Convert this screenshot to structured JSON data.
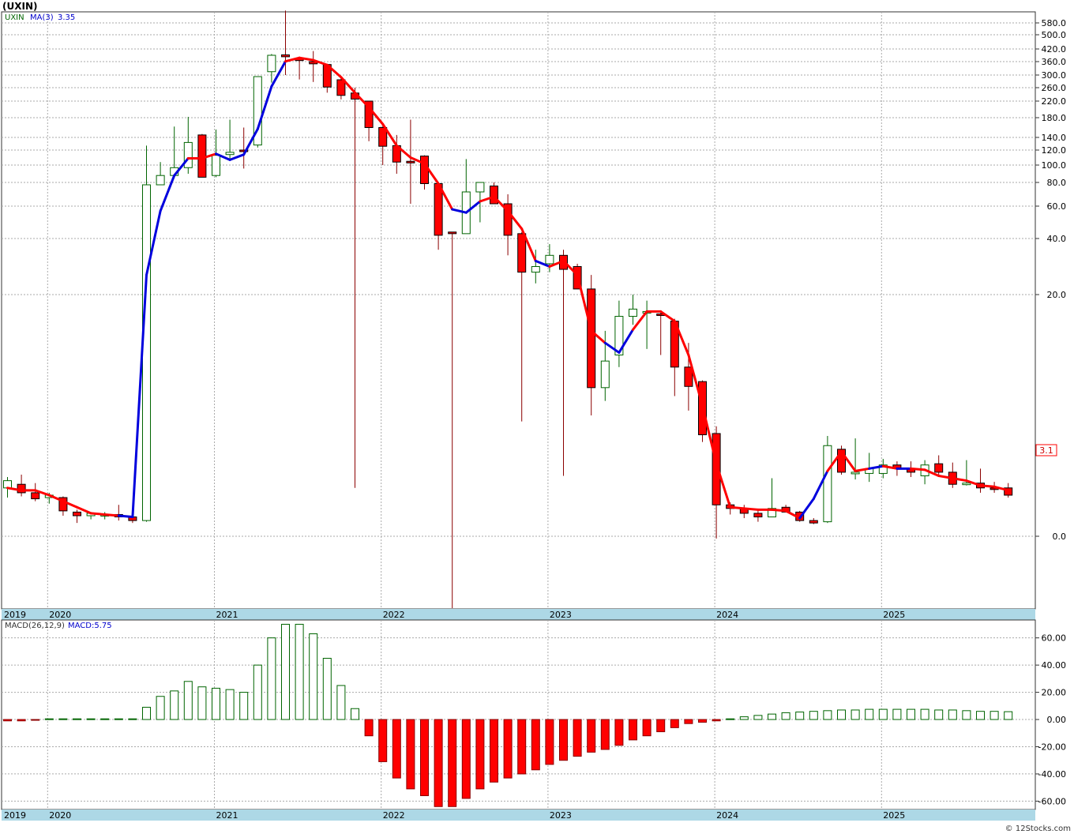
{
  "title": "(UXIN)",
  "watermark": "© 12Stocks.com",
  "colors": {
    "up": "#006400",
    "down": "#ff0000",
    "ma_up": "#0000dd",
    "ma_down": "#ff0000",
    "band": "#add8e6",
    "grid": "#aaaaaa"
  },
  "chart_data": [
    {
      "type": "candlestick",
      "legend": {
        "ticker": "UXIN",
        "ma_label": "MA(3)",
        "ma_value": "3.35"
      },
      "scale": "custom-nonlinear",
      "last_price_label": "3.1",
      "y_ticks": [
        "580.0",
        "500.0",
        "420.0",
        "360.0",
        "300.0",
        "260.0",
        "220.0",
        "180.0",
        "140.0",
        "120.0",
        "100.0",
        "80.0",
        "60.0",
        "40.0",
        "20.0",
        "0.0"
      ],
      "x_labels": [
        "2019",
        "2020",
        "2021",
        "2022",
        "2023",
        "2024",
        "2025"
      ],
      "candles": [
        {
          "o": 4.0,
          "h": 4.9,
          "l": 3.2,
          "c": 4.6
        },
        {
          "o": 4.3,
          "h": 5.1,
          "l": 3.3,
          "c": 3.6
        },
        {
          "o": 3.6,
          "h": 4.4,
          "l": 2.9,
          "c": 3.1
        },
        {
          "o": 3.2,
          "h": 3.6,
          "l": 2.7,
          "c": 3.4
        },
        {
          "o": 3.2,
          "h": 3.3,
          "l": 1.7,
          "c": 2.1
        },
        {
          "o": 2.0,
          "h": 2.2,
          "l": 1.1,
          "c": 1.7
        },
        {
          "o": 1.7,
          "h": 2.0,
          "l": 1.4,
          "c": 1.9
        },
        {
          "o": 1.8,
          "h": 2.0,
          "l": 1.4,
          "c": 1.8
        },
        {
          "o": 1.8,
          "h": 2.6,
          "l": 1.3,
          "c": 1.6
        },
        {
          "o": 1.6,
          "h": 2.1,
          "l": 1.1,
          "c": 1.3
        },
        {
          "o": 1.3,
          "h": 127,
          "l": 1.2,
          "c": 78
        },
        {
          "o": 78,
          "h": 104,
          "l": 78,
          "c": 88
        },
        {
          "o": 88,
          "h": 162,
          "l": 85,
          "c": 97
        },
        {
          "o": 97,
          "h": 182,
          "l": 90,
          "c": 132
        },
        {
          "o": 145,
          "h": 147,
          "l": 86,
          "c": 86
        },
        {
          "o": 88,
          "h": 156,
          "l": 86,
          "c": 113
        },
        {
          "o": 114,
          "h": 176,
          "l": 108,
          "c": 117
        },
        {
          "o": 120,
          "h": 160,
          "l": 96,
          "c": 118
        },
        {
          "o": 128,
          "h": 270,
          "l": 124,
          "c": 295
        },
        {
          "o": 315,
          "h": 396,
          "l": 276,
          "c": 390
        },
        {
          "o": 392,
          "h": 690,
          "l": 300,
          "c": 383
        },
        {
          "o": 375,
          "h": 370,
          "l": 286,
          "c": 365
        },
        {
          "o": 360,
          "h": 410,
          "l": 278,
          "c": 350
        },
        {
          "o": 347,
          "h": 350,
          "l": 245,
          "c": 262
        },
        {
          "o": 285,
          "h": 290,
          "l": 225,
          "c": 237
        },
        {
          "o": 244,
          "h": 260,
          "l": 4.0,
          "c": 226
        },
        {
          "o": 220,
          "h": 190,
          "l": 134,
          "c": 160
        },
        {
          "o": 160,
          "h": 165,
          "l": 100,
          "c": 126
        },
        {
          "o": 127,
          "h": 145,
          "l": 90,
          "c": 104
        },
        {
          "o": 105,
          "h": 176,
          "l": 62,
          "c": 103
        },
        {
          "o": 112,
          "h": 113,
          "l": 74,
          "c": 79
        },
        {
          "o": 79,
          "h": 72,
          "l": 36,
          "c": 42
        },
        {
          "o": 44,
          "h": 44,
          "l": -16,
          "c": 43
        },
        {
          "o": 43,
          "h": 108,
          "l": 43,
          "c": 72
        },
        {
          "o": 72,
          "h": 80,
          "l": 50,
          "c": 80
        },
        {
          "o": 77,
          "h": 80,
          "l": 62,
          "c": 62
        },
        {
          "o": 62,
          "h": 70,
          "l": 34,
          "c": 42
        },
        {
          "o": 43,
          "h": 44,
          "l": 9.5,
          "c": 28
        },
        {
          "o": 28,
          "h": 36,
          "l": 24,
          "c": 30
        },
        {
          "o": 31,
          "h": 38,
          "l": 28,
          "c": 34
        },
        {
          "o": 34,
          "h": 36,
          "l": 5.0,
          "c": 29
        },
        {
          "o": 30,
          "h": 31,
          "l": 22,
          "c": 22
        },
        {
          "o": 22,
          "h": 27,
          "l": 10,
          "c": 12.3
        },
        {
          "o": 12.3,
          "h": 17,
          "l": 11.2,
          "c": 14.5
        },
        {
          "o": 15,
          "h": 19.5,
          "l": 14,
          "c": 18.2
        },
        {
          "o": 18.2,
          "h": 20,
          "l": 17.5,
          "c": 18.8
        },
        {
          "o": 18.6,
          "h": 19.5,
          "l": 15.5,
          "c": 18.6
        },
        {
          "o": 18.4,
          "h": 18.6,
          "l": 15,
          "c": 18.3
        },
        {
          "o": 17.8,
          "h": 18,
          "l": 11.6,
          "c": 14
        },
        {
          "o": 14,
          "h": 16,
          "l": 10.4,
          "c": 12.4
        },
        {
          "o": 12.8,
          "h": 12.9,
          "l": 7.8,
          "c": 8.4
        },
        {
          "o": 8.5,
          "h": 9.1,
          "l": -0.5,
          "c": 2.6
        },
        {
          "o": 2.6,
          "h": 2.8,
          "l": 1.8,
          "c": 2.3
        },
        {
          "o": 2.3,
          "h": 2.6,
          "l": 1.5,
          "c": 1.9
        },
        {
          "o": 1.9,
          "h": 2.1,
          "l": 1.2,
          "c": 1.6
        },
        {
          "o": 1.6,
          "h": 4.8,
          "l": 1.6,
          "c": 2.3
        },
        {
          "o": 2.4,
          "h": 2.6,
          "l": 2.0,
          "c": 2.0
        },
        {
          "o": 2.0,
          "h": 2.1,
          "l": 1.2,
          "c": 1.3
        },
        {
          "o": 1.3,
          "h": 1.5,
          "l": 1.0,
          "c": 1.1
        },
        {
          "o": 1.2,
          "h": 8.3,
          "l": 1.1,
          "c": 7.5
        },
        {
          "o": 7.2,
          "h": 7.5,
          "l": 5.1,
          "c": 5.3
        },
        {
          "o": 5.3,
          "h": 8.1,
          "l": 4.7,
          "c": 5.3
        },
        {
          "o": 5.2,
          "h": 6.9,
          "l": 4.5,
          "c": 5.6
        },
        {
          "o": 5.2,
          "h": 6.4,
          "l": 4.8,
          "c": 5.9
        },
        {
          "o": 5.9,
          "h": 6.2,
          "l": 5.0,
          "c": 5.6
        },
        {
          "o": 5.6,
          "h": 6.2,
          "l": 4.9,
          "c": 5.3
        },
        {
          "o": 5.0,
          "h": 6.3,
          "l": 4.3,
          "c": 5.9
        },
        {
          "o": 6.0,
          "h": 6.7,
          "l": 5.1,
          "c": 5.3
        },
        {
          "o": 5.3,
          "h": 6.1,
          "l": 4.0,
          "c": 4.3
        },
        {
          "o": 4.3,
          "h": 6.3,
          "l": 4.2,
          "c": 4.4
        },
        {
          "o": 4.4,
          "h": 5.6,
          "l": 3.6,
          "c": 4.0
        },
        {
          "o": 4.0,
          "h": 4.5,
          "l": 3.6,
          "c": 3.9
        },
        {
          "o": 4.0,
          "h": 4.4,
          "l": 3.2,
          "c": 3.4
        }
      ],
      "ma": [
        4.0,
        3.8,
        3.8,
        3.4,
        2.9,
        2.4,
        1.9,
        1.8,
        1.7,
        1.6,
        27,
        57,
        88,
        109,
        109,
        115,
        107,
        114,
        157,
        264,
        361,
        378,
        367,
        345,
        293,
        245,
        205,
        167,
        127,
        110,
        102,
        79,
        58,
        56,
        64,
        68,
        57,
        46,
        32,
        30,
        32,
        27,
        17,
        16,
        15.2,
        17.1,
        18.6,
        18.6,
        17.8,
        15,
        10.8,
        6.0,
        2.4,
        2.3,
        2.2,
        2.2,
        2.1,
        1.5,
        3.1,
        5.4,
        7.0,
        5.4,
        5.6,
        5.8,
        5.6,
        5.6,
        5.5,
        5.0,
        4.8,
        4.6,
        4.2,
        4.1,
        3.8
      ],
      "ma_color_index": [
        0,
        0,
        0,
        0,
        0,
        0,
        0,
        0,
        0,
        1,
        1,
        1,
        1,
        1,
        0,
        0,
        1,
        1,
        1,
        1,
        1,
        0,
        0,
        0,
        0,
        0,
        0,
        0,
        0,
        0,
        0,
        0,
        0,
        1,
        1,
        0,
        0,
        0,
        0,
        1,
        0,
        0,
        0,
        0,
        1,
        1,
        0,
        0,
        0,
        0,
        0,
        0,
        0,
        0,
        0,
        0,
        0,
        0,
        1,
        1,
        0,
        0,
        0,
        1,
        0,
        1,
        0,
        0,
        0,
        0,
        0,
        0,
        0
      ]
    },
    {
      "type": "bar",
      "legend": {
        "label": "MACD(26,12,9)",
        "value_label": "MACD:5.75"
      },
      "y_ticks": [
        "60.00",
        "40.00",
        "20.00",
        "0.00",
        "-20.00",
        "-40.00",
        "-60.00"
      ],
      "ylim": [
        -65,
        72
      ],
      "x_labels": [
        "2019",
        "2020",
        "2021",
        "2022",
        "2023",
        "2024",
        "2025"
      ],
      "values": [
        -1,
        -1,
        -0.5,
        0.5,
        0.5,
        0.5,
        0.5,
        0.5,
        0.5,
        0.5,
        9,
        17,
        21,
        28,
        24,
        23,
        22,
        20,
        40,
        60,
        70,
        70,
        63,
        45,
        25,
        8,
        -12,
        -31,
        -43,
        -51,
        -56,
        -64,
        -64,
        -58,
        -51,
        -46,
        -43,
        -40,
        -37,
        -33,
        -30,
        -27,
        -24,
        -22,
        -19,
        -15,
        -12,
        -9,
        -6,
        -3,
        -2,
        -1,
        0.5,
        2,
        3,
        4,
        5,
        5.5,
        6,
        6.5,
        7,
        7,
        7.5,
        7.5,
        7.5,
        7.5,
        7.5,
        7,
        7,
        6.5,
        6,
        6,
        5.75
      ]
    }
  ]
}
